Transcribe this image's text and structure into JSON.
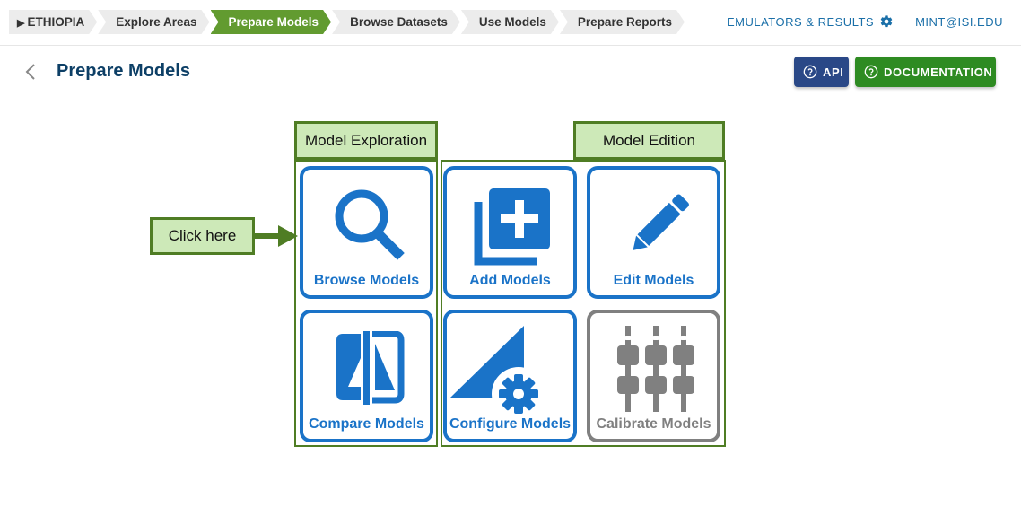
{
  "breadcrumbs": [
    {
      "label": "ETHIOPIA",
      "active": false
    },
    {
      "label": "Explore Areas",
      "active": false
    },
    {
      "label": "Prepare Models",
      "active": true
    },
    {
      "label": "Browse Datasets",
      "active": false
    },
    {
      "label": "Use Models",
      "active": false
    },
    {
      "label": "Prepare Reports",
      "active": false
    }
  ],
  "header_links": {
    "emulators": "EMULATORS & RESULTS",
    "user": "MINT@ISI.EDU"
  },
  "page": {
    "title": "Prepare Models"
  },
  "buttons": {
    "api": "API",
    "documentation": "DOCUMENTATION"
  },
  "annotations": {
    "exploration": "Model Exploration",
    "edition": "Model Edition",
    "click_here": "Click here"
  },
  "tiles": {
    "browse": "Browse Models",
    "add": "Add Models",
    "edit": "Edit Models",
    "compare": "Compare Models",
    "configure": "Configure Models",
    "calibrate": "Calibrate Models"
  },
  "colors": {
    "brand_blue": "#1a73c8",
    "active_green": "#629b30",
    "annotation_green": "#4f7d24",
    "disabled_gray": "#808080"
  },
  "icons": [
    "gear-icon",
    "back-chevron-icon",
    "help-circle-icon",
    "search-icon",
    "add-box-icon",
    "pencil-icon",
    "compare-icon",
    "configure-icon",
    "sliders-icon",
    "arrow-right-icon"
  ]
}
